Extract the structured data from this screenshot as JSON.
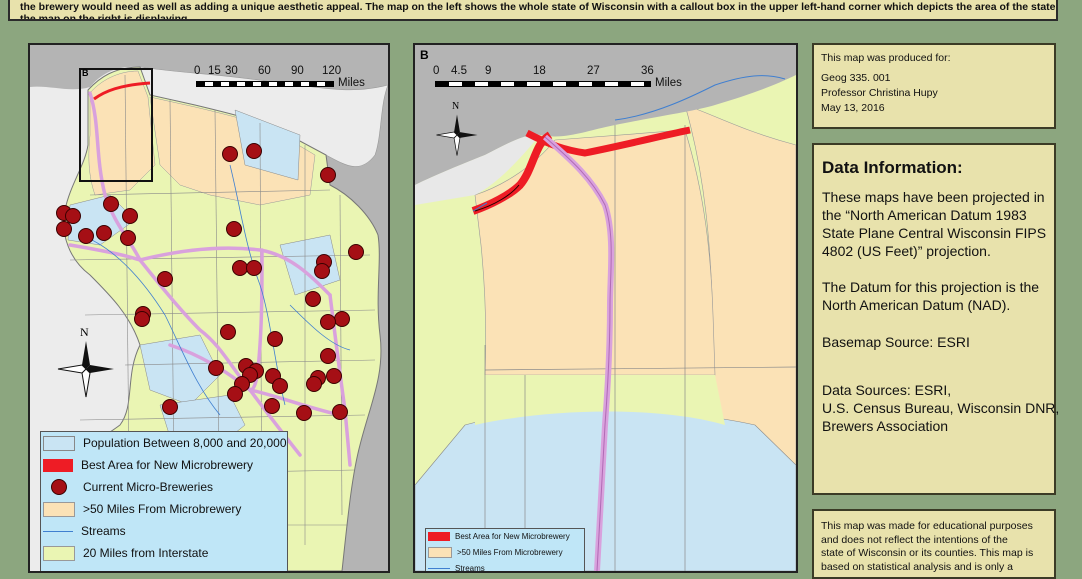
{
  "intro": {
    "line1": "the brewery would need as well as adding a unique aesthetic appeal. The map on the left shows the whole state of Wisconsin with a callout box in the upper left-hand corner which depicts the area of the state",
    "line2": "the map on the right is displaying."
  },
  "left_map": {
    "callout_label": "B",
    "north_label": "N",
    "scale": {
      "ticks": [
        "0",
        "15",
        "30",
        "60",
        "90",
        "120"
      ],
      "unit": "Miles"
    },
    "legend": [
      {
        "label": "Population Between 8,000 and 20,000",
        "symbol": "population-area",
        "color": "#c9e4f3"
      },
      {
        "label": "Best Area for New Microbrewery",
        "symbol": "best-area",
        "color": "#ee1c25"
      },
      {
        "label": "Current Micro-Breweries",
        "symbol": "brewery-dot",
        "color": "#a50f15"
      },
      {
        "label": ">50 Miles From Microbrewery",
        "symbol": "far-area",
        "color": "#fbe2b6"
      },
      {
        "label": "Streams",
        "symbol": "stream-line",
        "color": "#3f7fd0"
      },
      {
        "label": "20 Miles from Interstate",
        "symbol": "interstate-buffer",
        "color": "#eaf5b3"
      }
    ]
  },
  "right_map": {
    "frame_label": "B",
    "north_label": "N",
    "scale": {
      "ticks": [
        "0",
        "4.5",
        "9",
        "18",
        "27",
        "36"
      ],
      "unit": "Miles"
    },
    "legend": [
      {
        "label": "Best Area for New Microbrewery",
        "symbol": "best-area",
        "color": "#ee1c25"
      },
      {
        "label": ">50 Miles From Microbrewery",
        "symbol": "far-area",
        "color": "#fbe2b6"
      },
      {
        "label": "Streams",
        "symbol": "stream-line",
        "color": "#3f7fd0"
      }
    ]
  },
  "produced_for": {
    "lines": [
      "This map was produced for:",
      "Geog 335. 001",
      "Professor Christina Hupy",
      "May 13, 2016"
    ]
  },
  "data_info": {
    "title": "Data Information:",
    "paragraphs": [
      [
        "These maps have been projected in",
        "the “North American Datum 1983",
        "State Plane Central Wisconsin FIPS",
        "4802 (US Feet)” projection."
      ],
      [
        "The Datum for this projection is the",
        "North American Datum (NAD)."
      ],
      [
        "Basemap Source: ESRI"
      ],
      [
        "Data Sources: ESRI,",
        "U.S. Census Bureau, Wisconsin DNR,",
        "Brewers Association"
      ]
    ]
  },
  "disclaimer": {
    "lines": [
      "This map was made for educational purposes",
      "and does not reflect the intentions of the",
      "state of Wisconsin or its counties. This map is",
      "based on statistical analysis and is only a"
    ]
  },
  "colors": {
    "page_bg": "#8ca67f",
    "panel_bg": "#e8e2ac",
    "lake_gray": "#b4b4b4",
    "land_base": "#eaf5b3",
    "far_area": "#fbe2b6",
    "pop_area": "#c9e4f3",
    "brewery": "#a50f15",
    "best_area": "#ee1c25",
    "highway": "#d9a1dd",
    "stream": "#3f7fd0"
  }
}
